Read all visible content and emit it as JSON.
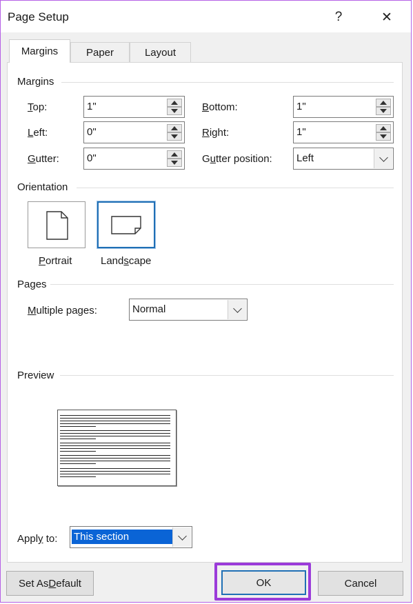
{
  "window": {
    "title": "Page Setup",
    "help_glyph": "?",
    "close_glyph": "✕"
  },
  "tabs": [
    {
      "label": "Margins"
    },
    {
      "label": "Paper"
    },
    {
      "label": "Layout"
    }
  ],
  "margins": {
    "section_label": "Margins",
    "top": {
      "label_u": "T",
      "label_rest": "op:",
      "value": "1\""
    },
    "bottom": {
      "label_u": "B",
      "label_rest": "ottom:",
      "value": "1\""
    },
    "left": {
      "label_u": "L",
      "label_rest": "eft:",
      "value": "0\""
    },
    "right": {
      "label_u": "R",
      "label_rest": "ight:",
      "value": "1\""
    },
    "gutter": {
      "label_u": "G",
      "label_rest": "utter:",
      "value": "0\""
    },
    "gutter_position": {
      "label_pre": "G",
      "label_u": "u",
      "label_rest": "tter position:",
      "value": "Left"
    }
  },
  "orientation": {
    "section_label": "Orientation",
    "portrait": {
      "label_u": "P",
      "label_rest": "ortrait"
    },
    "landscape": {
      "label_pre": "Land",
      "label_u": "s",
      "label_rest": "cape",
      "selected": true
    }
  },
  "pages": {
    "section_label": "Pages",
    "multiple_pages_label_u": "M",
    "multiple_pages_label_rest": "ultiple pages:",
    "multiple_pages_value": "Normal"
  },
  "preview": {
    "section_label": "Preview"
  },
  "apply_to": {
    "label_pre": "Appl",
    "label_u": "y",
    "label_rest": " to:",
    "value": "This section"
  },
  "buttons": {
    "set_default_pre": "Set As ",
    "set_default_u": "D",
    "set_default_rest": "efault",
    "ok": "OK",
    "cancel": "Cancel"
  },
  "colors": {
    "highlight": "#9b3bd9",
    "selection": "#0a64d6"
  }
}
